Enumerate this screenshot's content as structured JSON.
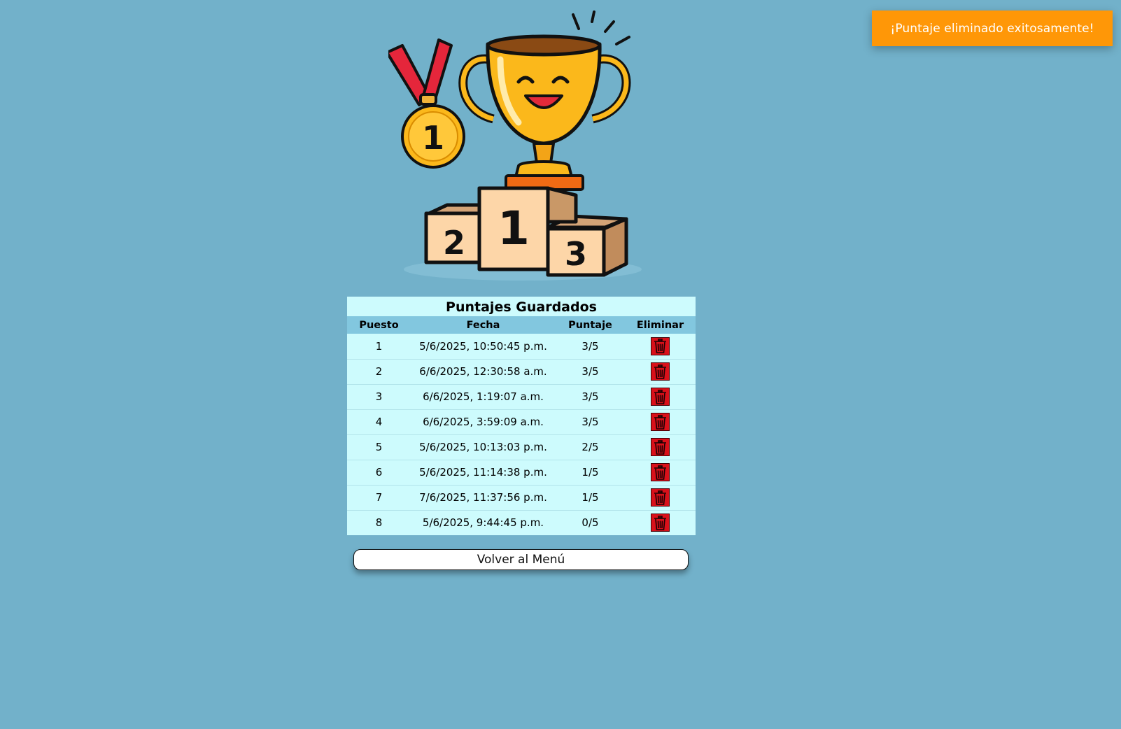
{
  "toast": {
    "message": "¡Puntaje eliminado exitosamente!",
    "color": "#ff9707"
  },
  "illustration": {
    "name": "trophy-podium-illustration",
    "medal_number": "1",
    "podium": [
      "2",
      "1",
      "3"
    ]
  },
  "scores": {
    "title": "Puntajes Guardados",
    "headers": [
      "Puesto",
      "Fecha",
      "Puntaje",
      "Eliminar"
    ],
    "rows": [
      {
        "rank": "1",
        "date": "5/6/2025, 10:50:45 p.m.",
        "score": "3/5"
      },
      {
        "rank": "2",
        "date": "6/6/2025, 12:30:58 a.m.",
        "score": "3/5"
      },
      {
        "rank": "3",
        "date": "6/6/2025, 1:19:07 a.m.",
        "score": "3/5"
      },
      {
        "rank": "4",
        "date": "6/6/2025, 3:59:09 a.m.",
        "score": "3/5"
      },
      {
        "rank": "5",
        "date": "5/6/2025, 10:13:03 p.m.",
        "score": "2/5"
      },
      {
        "rank": "6",
        "date": "5/6/2025, 11:14:38 p.m.",
        "score": "1/5"
      },
      {
        "rank": "7",
        "date": "7/6/2025, 11:37:56 p.m.",
        "score": "1/5"
      },
      {
        "rank": "8",
        "date": "5/6/2025, 9:44:45 p.m.",
        "score": "0/5"
      }
    ],
    "delete_icon": "trash-icon"
  },
  "back_button": {
    "label": "Volver al Menú"
  },
  "colors": {
    "background": "#72b1ca",
    "table_bg": "#cdfbfd",
    "header_bg": "#82c7df",
    "delete": "#d9101a"
  }
}
